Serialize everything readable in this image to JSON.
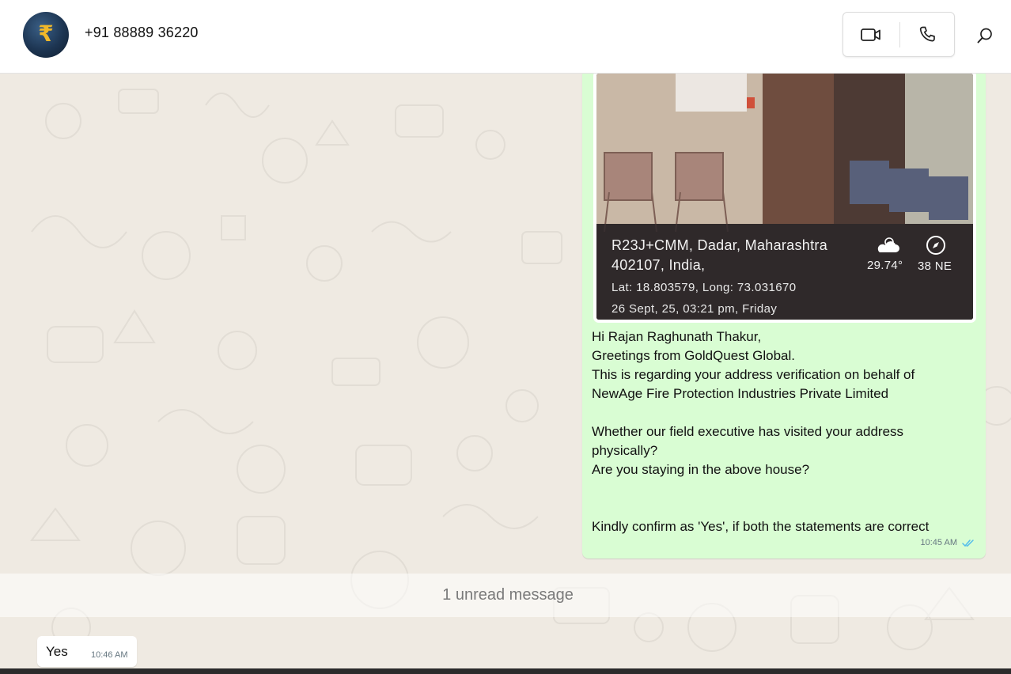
{
  "header": {
    "contact_name": "+91 88889 36220",
    "avatar_icon": "rupee-coin-avatar",
    "avatar_glyph": "₹",
    "video_call_icon": "video-camera-icon",
    "voice_call_icon": "phone-icon",
    "search_icon": "search-icon"
  },
  "outgoing_message": {
    "photo_overlay": {
      "address_line1": "R23J+CMM, Dadar, Maharashtra",
      "address_line2": "402107, India,",
      "lat_long": "Lat: 18.803579, Long: 73.031670",
      "datetime": "26 Sept, 25, 03:21 pm, Friday",
      "temperature": "29.74°",
      "direction": "38 NE"
    },
    "text": "Hi Rajan Raghunath Thakur,\nGreetings from GoldQuest Global.\nThis is regarding your address verification on behalf of\nNewAge Fire Protection Industries Private Limited\n\nWhether our field executive has visited your address\nphysically?\nAre you staying in the above house?\n\n\nKindly confirm as 'Yes', if both the statements are correct",
    "time": "10:45 AM",
    "status_icon": "double-check-read-icon"
  },
  "unread_banner": {
    "text": "1 unread message"
  },
  "incoming_message": {
    "text": "Yes",
    "time": "10:46 AM"
  },
  "colors": {
    "outgoing_bubble": "#d9fdd3",
    "incoming_bubble": "#ffffff",
    "chat_background": "#efeae2",
    "read_ticks": "#53bdeb"
  }
}
